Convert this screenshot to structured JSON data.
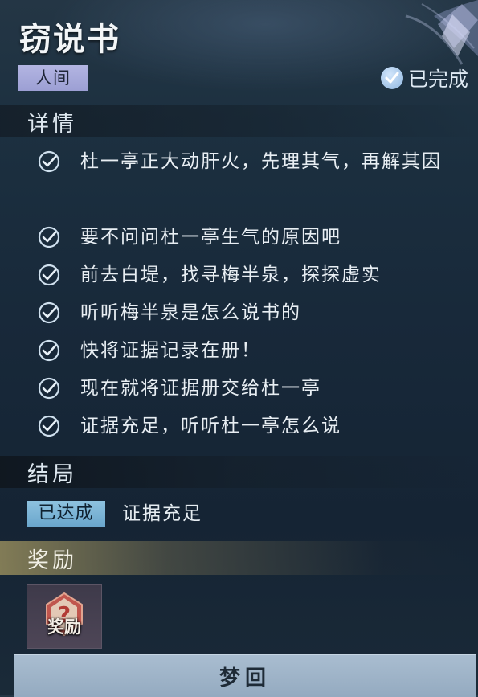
{
  "quest": {
    "title": "窃说书",
    "realm_tag": "人间",
    "status": "已完成",
    "status_icon": "checkmark-circle-icon"
  },
  "details": {
    "heading": "详情",
    "tasks": [
      {
        "text": "杜一亭正大动肝火，先理其气，再解其因",
        "done": true
      },
      {
        "text": "要不问问杜一亭生气的原因吧",
        "done": true
      },
      {
        "text": "前去白堤，找寻梅半泉，探探虚实",
        "done": true
      },
      {
        "text": "听听梅半泉是怎么说书的",
        "done": true
      },
      {
        "text": "快将证据记录在册！",
        "done": true
      },
      {
        "text": "现在就将证据册交给杜一亭",
        "done": true
      },
      {
        "text": "证据充足，听听杜一亭怎么说",
        "done": true
      }
    ]
  },
  "ending": {
    "heading": "结局",
    "achieved_tag": "已达成",
    "result": "证据充足"
  },
  "reward": {
    "heading": "奖励",
    "item_label": "奖励",
    "item_icon": "question-emblem-icon"
  },
  "actions": {
    "dream_return": "梦回"
  },
  "colors": {
    "tag_realm": "#a9abdc",
    "tag_achieved": "#7cb4d6",
    "button": "#a1b5ca",
    "background": "#1b2d3c"
  }
}
